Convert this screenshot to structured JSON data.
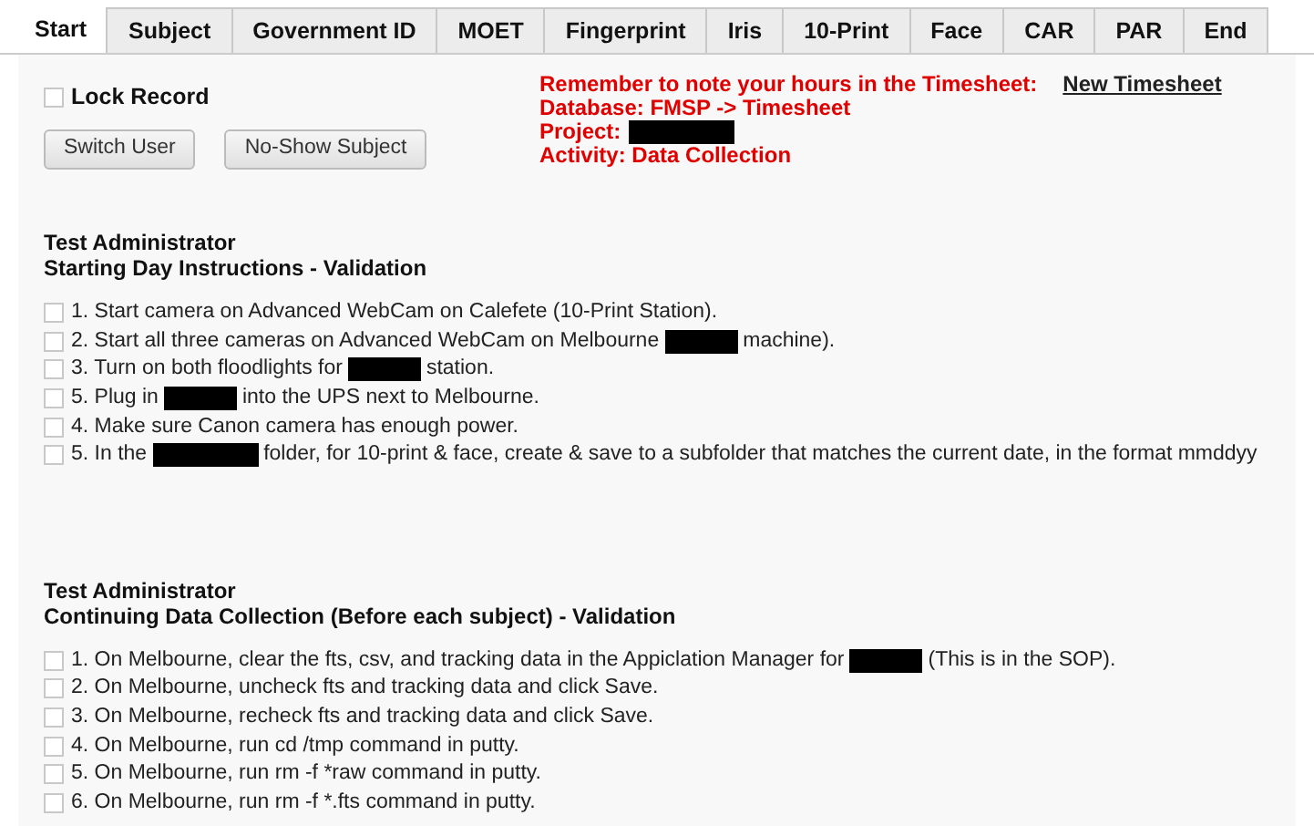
{
  "tabs": [
    {
      "label": "Start",
      "selected": true
    },
    {
      "label": "Subject",
      "selected": false
    },
    {
      "label": "Government ID",
      "selected": false
    },
    {
      "label": "MOET",
      "selected": false
    },
    {
      "label": "Fingerprint",
      "selected": false
    },
    {
      "label": "Iris",
      "selected": false
    },
    {
      "label": "10-Print",
      "selected": false
    },
    {
      "label": "Face",
      "selected": false
    },
    {
      "label": "CAR",
      "selected": false
    },
    {
      "label": "PAR",
      "selected": false
    },
    {
      "label": "End",
      "selected": false
    }
  ],
  "lock_record": {
    "label": "Lock Record",
    "checked": false
  },
  "buttons": [
    "Switch User",
    "No-Show Subject"
  ],
  "notice": {
    "lines": [
      [
        {
          "kind": "text",
          "text": "Remember to note your hours in the Timesheet:"
        },
        {
          "kind": "link",
          "text": "New Timesheet"
        }
      ],
      [
        {
          "kind": "text",
          "text": "Database: FMSP -> Timesheet"
        }
      ],
      [
        {
          "kind": "text",
          "text": "Project:"
        },
        {
          "kind": "redacted",
          "wide": true
        }
      ],
      [
        {
          "kind": "text",
          "text": "Activity: Data Collection"
        }
      ]
    ]
  },
  "sections": [
    {
      "role": "Test Administrator",
      "title": "Starting Day Instructions - Validation",
      "items": [
        {
          "checked": false,
          "parts": [
            {
              "kind": "text",
              "text": "1. Start camera on Advanced WebCam on Calefete (10-Print Station)."
            }
          ]
        },
        {
          "checked": false,
          "parts": [
            {
              "kind": "text",
              "text": "2. Start all three cameras on Advanced WebCam on Melbourne"
            },
            {
              "kind": "redacted",
              "wide": false
            },
            {
              "kind": "text",
              "text": "machine)."
            }
          ]
        },
        {
          "checked": false,
          "parts": [
            {
              "kind": "text",
              "text": "3. Turn on both floodlights for"
            },
            {
              "kind": "redacted",
              "wide": false
            },
            {
              "kind": "text",
              "text": "station."
            }
          ]
        },
        {
          "checked": false,
          "parts": [
            {
              "kind": "text",
              "text": "5. Plug in"
            },
            {
              "kind": "redacted",
              "wide": false
            },
            {
              "kind": "text",
              "text": "into the UPS next to Melbourne."
            }
          ]
        },
        {
          "checked": false,
          "parts": [
            {
              "kind": "text",
              "text": "4. Make sure Canon camera has enough power."
            }
          ]
        },
        {
          "checked": false,
          "parts": [
            {
              "kind": "text",
              "text": "5. In the"
            },
            {
              "kind": "redacted",
              "wide": true
            },
            {
              "kind": "text",
              "text": "folder, for 10-print & face, create & save to a subfolder that matches the current date, in the format mmddyy"
            }
          ]
        }
      ]
    },
    {
      "role": "Test Administrator",
      "title": "Continuing Data Collection (Before each subject) - Validation",
      "items": [
        {
          "checked": false,
          "parts": [
            {
              "kind": "text",
              "text": "1. On Melbourne, clear the fts, csv, and tracking data in the Appiclation Manager for"
            },
            {
              "kind": "redacted",
              "wide": false
            },
            {
              "kind": "text",
              "text": "(This is in the SOP)."
            }
          ]
        },
        {
          "checked": false,
          "parts": [
            {
              "kind": "text",
              "text": "2. On Melbourne, uncheck fts and tracking data and click Save."
            }
          ]
        },
        {
          "checked": false,
          "parts": [
            {
              "kind": "text",
              "text": "3. On Melbourne, recheck fts and tracking data and click Save."
            }
          ]
        },
        {
          "checked": false,
          "parts": [
            {
              "kind": "text",
              "text": "4. On Melbourne, run cd /tmp command in putty."
            }
          ]
        },
        {
          "checked": false,
          "parts": [
            {
              "kind": "text",
              "text": "5. On Melbourne, run rm -f *raw command in putty."
            }
          ]
        },
        {
          "checked": false,
          "parts": [
            {
              "kind": "text",
              "text": "6. On Melbourne, run rm -f *.fts command in putty."
            }
          ]
        }
      ]
    }
  ]
}
